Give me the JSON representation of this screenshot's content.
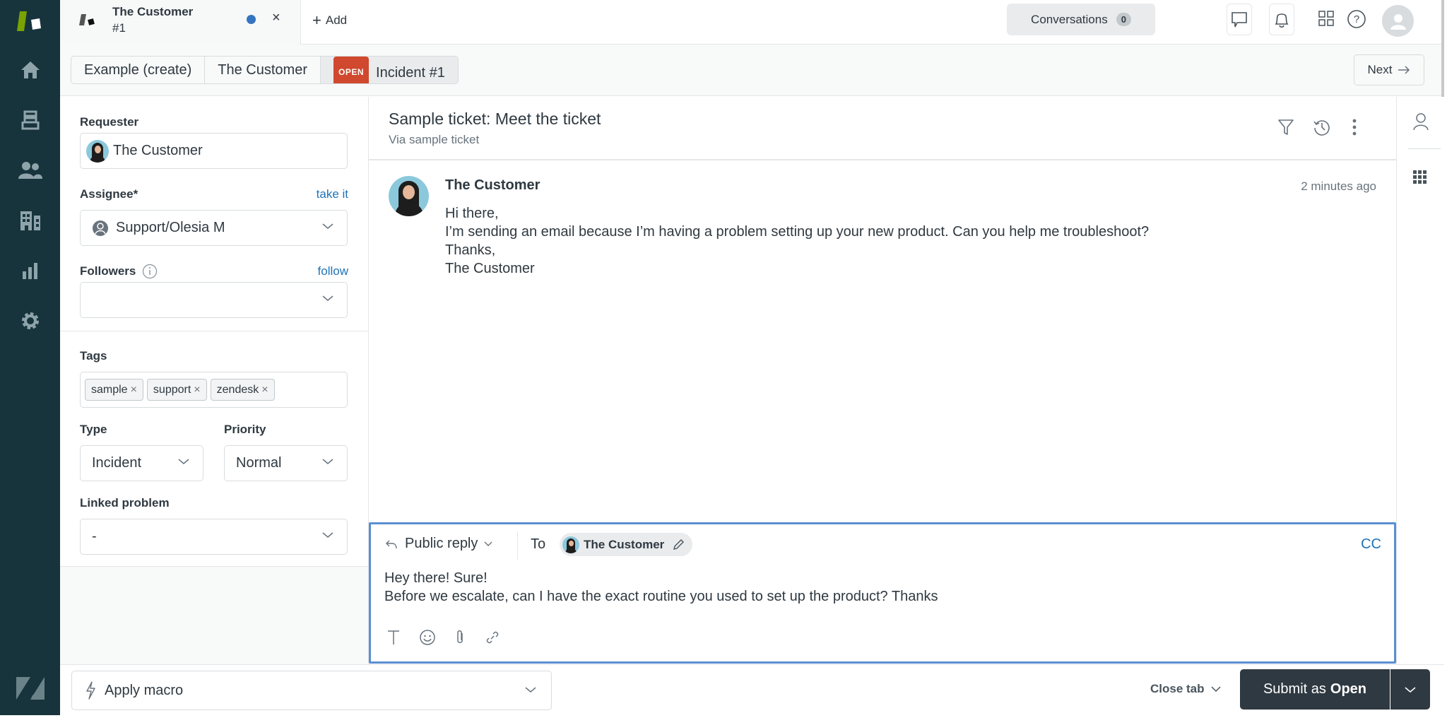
{
  "topbar": {
    "tab": {
      "title": "The Customer",
      "subtitle": "#1",
      "unsaved_dot_color": "#3574c1"
    },
    "add_label": "Add",
    "conversations_label": "Conversations",
    "conversations_count": "0"
  },
  "breadcrumb": {
    "items": [
      "Example (create)",
      "The Customer"
    ],
    "status_badge": "OPEN",
    "ticket_label": "Incident #1",
    "next_label": "Next"
  },
  "properties": {
    "requester_label": "Requester",
    "requester_value": "The Customer",
    "assignee_label": "Assignee*",
    "assignee_link": "take it",
    "assignee_value": "Support/Olesia M",
    "followers_label": "Followers",
    "followers_link": "follow",
    "followers_value": "",
    "tags_label": "Tags",
    "tags": [
      "sample",
      "support",
      "zendesk"
    ],
    "type_label": "Type",
    "type_value": "Incident",
    "priority_label": "Priority",
    "priority_value": "Normal",
    "linked_problem_label": "Linked problem",
    "linked_problem_value": "-"
  },
  "ticket": {
    "subject": "Sample ticket: Meet the ticket",
    "via": "Via sample ticket",
    "message": {
      "author": "The Customer",
      "time": "2 minutes ago",
      "lines": [
        "Hi there,",
        "I’m sending an email because I’m having a problem setting up your new product. Can you help me troubleshoot?",
        "Thanks,",
        "The Customer"
      ]
    }
  },
  "composer": {
    "reply_type": "Public reply",
    "to_label": "To",
    "recipient": "The Customer",
    "cc_label": "CC",
    "lines": [
      "Hey there! Sure!",
      "Before we escalate, can I have the exact routine you used to set up the product? Thanks"
    ]
  },
  "footer": {
    "macro_label": "Apply macro",
    "close_tab_label": "Close tab",
    "submit_prefix": "Submit as",
    "submit_status": "Open"
  },
  "colors": {
    "nav_bg": "#17343d",
    "accent_blue": "#1f73b7",
    "open_badge": "#d0482e",
    "submit_bg": "#2f3941"
  }
}
